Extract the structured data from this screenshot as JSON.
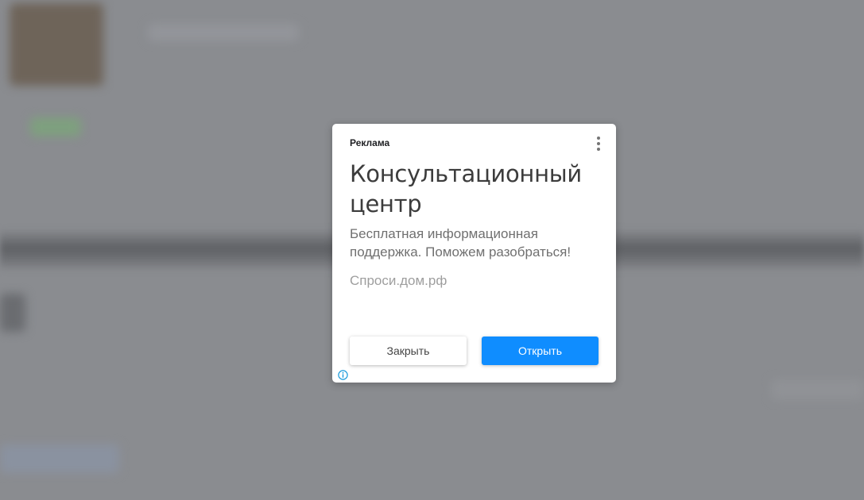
{
  "ad": {
    "label": "Реклама",
    "headline": "Консультационный центр",
    "description": "Бесплатная информационная поддержка. Поможем разобраться!",
    "advertiser": "Спроси.дом.рф",
    "close_button": "Закрыть",
    "open_button": "Открыть",
    "menu_icon": "more-vertical-icon",
    "info_icon": "info-icon"
  },
  "colors": {
    "overlay": "#8a8c90",
    "primary_button": "#0f8dff",
    "info_icon": "#1a9bdc"
  }
}
